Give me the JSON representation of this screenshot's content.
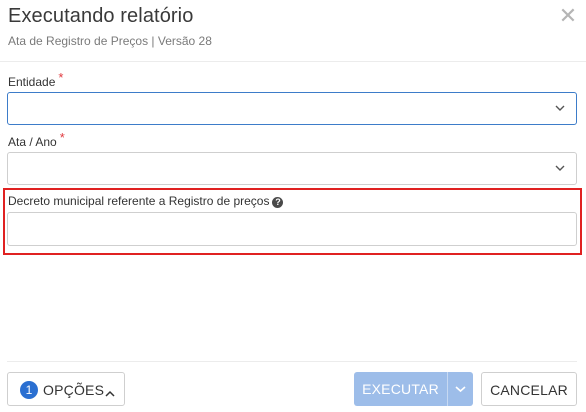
{
  "dialog": {
    "title": "Executando relatório",
    "subtitle": "Ata de Registro de Preços | Versão 28",
    "close_icon": "close-icon"
  },
  "form": {
    "entidade": {
      "label": "Entidade",
      "required_mark": "*",
      "value": ""
    },
    "ata_ano": {
      "label": "Ata / Ano",
      "required_mark": "*",
      "value": ""
    },
    "decreto": {
      "label": "Decreto municipal referente a Registro de preços",
      "help_icon": "?",
      "value": ""
    }
  },
  "footer": {
    "options_count": "1",
    "options_label": "OPÇÕES",
    "execute_label": "EXECUTAR",
    "cancel_label": "CANCELAR"
  },
  "colors": {
    "primary": "#2a6fd1",
    "execute_disabled": "#9dbde9",
    "focus_border": "#3d7cc9",
    "required": "#e0393e",
    "highlight": "#e02121"
  }
}
